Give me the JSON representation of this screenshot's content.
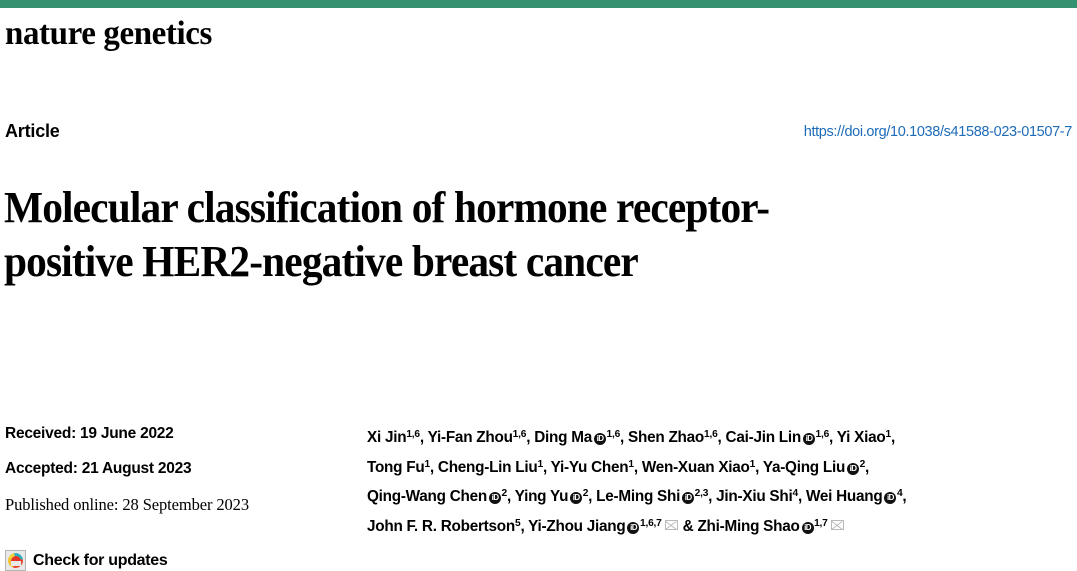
{
  "brand": {
    "bar_color": "#369170",
    "masthead": "nature genetics"
  },
  "header": {
    "article_type": "Article",
    "doi_url": "https://doi.org/10.1038/s41588-023-01507-7",
    "doi_color": "#1e6bb8"
  },
  "title": "Molecular classification of hormone receptor-positive HER2-negative breast cancer",
  "history": {
    "received": "Received: 19 June 2022",
    "accepted": "Accepted: 21 August 2023",
    "published": "Published online: 28 September 2023",
    "check_for_updates": "Check for updates",
    "crossmark_icon": "crossmark-icon"
  },
  "authors": {
    "line1": [
      {
        "name": "Xi Jin",
        "orcid": false,
        "sup": "1,6",
        "sep": ", "
      },
      {
        "name": "Yi-Fan Zhou",
        "orcid": false,
        "sup": "1,6",
        "sep": ", "
      },
      {
        "name": "Ding Ma",
        "orcid": true,
        "sup": "1,6",
        "sep": ", "
      },
      {
        "name": "Shen Zhao",
        "orcid": false,
        "sup": "1,6",
        "sep": ", "
      },
      {
        "name": "Cai-Jin Lin",
        "orcid": true,
        "sup": "1,6",
        "sep": ", "
      },
      {
        "name": "Yi Xiao",
        "orcid": false,
        "sup": "1",
        "sep": ","
      }
    ],
    "line2": [
      {
        "name": "Tong Fu",
        "orcid": false,
        "sup": "1",
        "sep": ", "
      },
      {
        "name": "Cheng-Lin Liu",
        "orcid": false,
        "sup": "1",
        "sep": ", "
      },
      {
        "name": "Yi-Yu Chen",
        "orcid": false,
        "sup": "1",
        "sep": ", "
      },
      {
        "name": "Wen-Xuan Xiao",
        "orcid": false,
        "sup": "1",
        "sep": ", "
      },
      {
        "name": "Ya-Qing Liu",
        "orcid": true,
        "sup": "2",
        "sep": ","
      }
    ],
    "line3": [
      {
        "name": "Qing-Wang Chen",
        "orcid": true,
        "sup": "2",
        "sep": ", "
      },
      {
        "name": "Ying Yu",
        "orcid": true,
        "sup": "2",
        "sep": ", "
      },
      {
        "name": "Le-Ming Shi",
        "orcid": true,
        "sup": "2,3",
        "sep": ", "
      },
      {
        "name": "Jin-Xiu Shi",
        "orcid": false,
        "sup": "4",
        "sep": ", "
      },
      {
        "name": "Wei Huang",
        "orcid": true,
        "sup": "4",
        "sep": ","
      }
    ],
    "line4": [
      {
        "name": "John F. R. Robertson",
        "orcid": false,
        "sup": "5",
        "sep": ", "
      },
      {
        "name": "Yi-Zhou Jiang",
        "orcid": true,
        "sup": "1,6,7",
        "envelope": true,
        "sep": " & "
      },
      {
        "name": "Zhi-Ming Shao",
        "orcid": true,
        "sup": "1,7",
        "envelope": true,
        "sep": ""
      }
    ],
    "orcid_icon": "orcid-id-icon",
    "envelope_icon": "envelope-icon"
  }
}
